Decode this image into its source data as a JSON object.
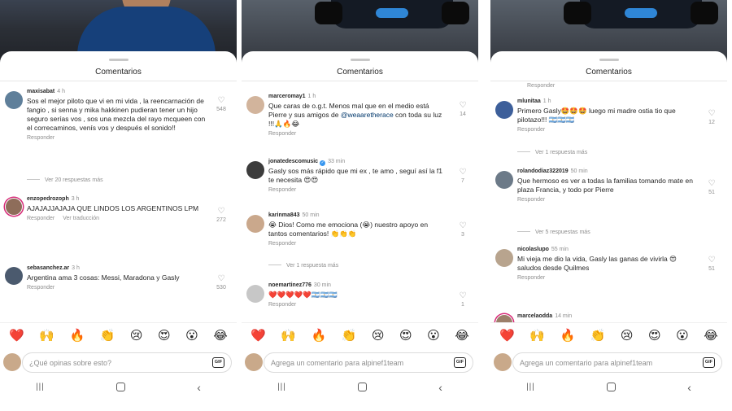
{
  "panels": [
    {
      "title": "Comentarios",
      "input_placeholder": "¿Qué opinas sobre esto?",
      "gif_label": "GIF",
      "top_actions": "",
      "comments": [
        {
          "user": "maxisabat",
          "time": "4 h",
          "verified": false,
          "text": "Sos el mejor piloto que vi en mi vida , la reencarnación de fangio , si senna y mika hakkinen pudieran tener un hijo seguro serías vos , sos una mezcla del rayo mcqueen con el correcaminos, venís vos y después el sonido!!",
          "reply": "Responder",
          "translate": "",
          "likes": "548",
          "replies_link": "Ver 20 respuestas más"
        },
        {
          "user": "enzopedrozoph",
          "time": "3 h",
          "verified": false,
          "text": "AJAJAJJAJAJA QUE LINDOS LOS ARGENTINOS LPM",
          "reply": "Responder",
          "translate": "Ver traducción",
          "likes": "272",
          "replies_link": ""
        },
        {
          "user": "sebasanchez.ar",
          "time": "3 h",
          "verified": false,
          "text": "Argentina ama 3 cosas: Messi, Maradona y Gasly",
          "reply": "Responder",
          "translate": "",
          "likes": "530",
          "replies_link": ""
        }
      ]
    },
    {
      "title": "Comentarios",
      "input_placeholder": "Agrega un comentario para alpinef1team",
      "gif_label": "GIF",
      "top_actions": "",
      "comments": [
        {
          "user": "marceromay1",
          "time": "1 h",
          "verified": false,
          "text": "Que caras de o.g.t. Menos mal que en el medio está Pierre y sus amigos de",
          "mention": "@weaaretherace",
          "text_after": " con toda su luz !!!🙏🔥😂",
          "reply": "Responder",
          "translate": "",
          "likes": "14",
          "replies_link": ""
        },
        {
          "user": "jonatedescomusic",
          "time": "33 min",
          "verified": true,
          "text": "Gasly sos más rápido que mi ex , te amo , seguí así la f1 te necesita 😍😍",
          "reply": "Responder",
          "translate": "",
          "likes": "7",
          "replies_link": ""
        },
        {
          "user": "karinma843",
          "time": "50 min",
          "verified": false,
          "text": "😭 Dios! Como me emociona (😭) nuestro apoyo en tantos comentarios! 👏👏👏",
          "reply": "Responder",
          "translate": "",
          "likes": "3",
          "replies_link": "Ver 1 respuesta más"
        },
        {
          "user": "noemartinez776",
          "time": "30 min",
          "verified": false,
          "text": "❤️❤️❤️❤️❤️🇦🇷🇦🇷🇦🇷",
          "reply": "Responder",
          "translate": "",
          "likes": "1",
          "replies_link": ""
        }
      ]
    },
    {
      "title": "Comentarios",
      "input_placeholder": "Agrega un comentario para alpinef1team",
      "gif_label": "GIF",
      "top_actions": "Responder",
      "comments": [
        {
          "user": "mlunitaa",
          "time": "1 h",
          "verified": false,
          "text": "Primero Gasly🤩🤩🤩 luego mi madre ostia tio que pilotazo!!! 🇦🇷🇦🇷🇦🇷",
          "reply": "Responder",
          "translate": "",
          "likes": "12",
          "replies_link": "Ver 1 respuesta más"
        },
        {
          "user": "rolandodiaz322019",
          "time": "50 min",
          "verified": false,
          "text": "Que hermoso es ver a todas la familias tomando mate en plaza Francia, y todo por Pierre",
          "reply": "Responder",
          "translate": "",
          "likes": "51",
          "replies_link": "Ver 5 respuestas más"
        },
        {
          "user": "nicolaslupo",
          "time": "55 min",
          "verified": false,
          "text": "Mi vieja me dio la vida, Gasly las ganas de vivirla 😍 saludos desde Quilmes",
          "reply": "Responder",
          "translate": "",
          "likes": "51",
          "replies_link": ""
        },
        {
          "user": "marcelaodda",
          "time": "14 min",
          "verified": false,
          "text": "",
          "reply": "",
          "translate": "",
          "likes": "",
          "replies_link": ""
        }
      ]
    }
  ],
  "emoji_bar": [
    "❤️",
    "🙌",
    "🔥",
    "👏",
    "😢",
    "😍",
    "😮",
    "😂"
  ],
  "nav": {
    "recent": "|||",
    "back": "‹"
  }
}
